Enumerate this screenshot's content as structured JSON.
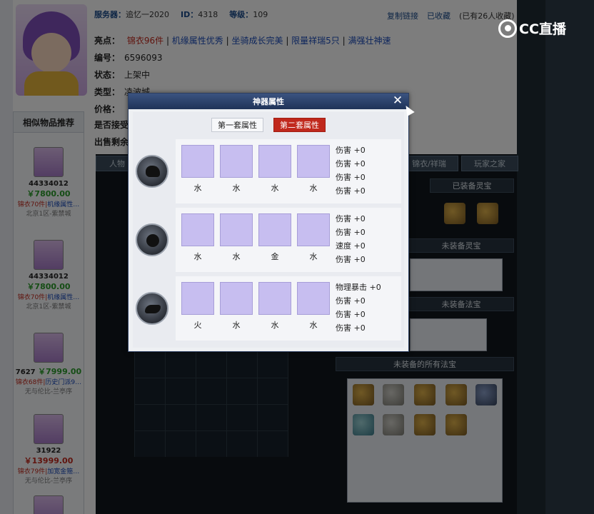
{
  "overlay": {
    "logo_text": "CC直播"
  },
  "page": {
    "server_label": "服务器：",
    "server_value": "追忆一2020",
    "id_label": "ID：",
    "id_value": "4318",
    "level_label": "等级：",
    "level_value": "109",
    "copy_link": "复制链接",
    "favorited": "已收藏",
    "fav_count": "(已有26人收藏)",
    "highlight_label": "亮点：",
    "highlight_items": [
      "锦衣96件",
      "机缘属性优秀",
      "坐骑成长完美",
      "限量祥瑞5只",
      "满强壮神速"
    ],
    "number_label": "编号：",
    "number_value": "6596093",
    "status_label": "状态：",
    "status_value": "上架中",
    "type_label": "类型：",
    "type_value": "凌波城",
    "price_label": "价格：",
    "accept_label": "是否接受",
    "remain_label": "出售剩余"
  },
  "sidebar": {
    "title": "相似物品推荐",
    "items": [
      {
        "id": "44334012",
        "price": "￥7800.00",
        "desc_red": "锦衣70件",
        "desc_blue": "机缘属性…",
        "server": "北京1区-紫禁城",
        "price_red": false
      },
      {
        "id": "44334012",
        "price": "￥7800.00",
        "desc_red": "锦衣70件",
        "desc_blue": "机缘属性…",
        "server": "北京1区-紫禁城",
        "price_red": false
      },
      {
        "id": "7627",
        "price": "￥7999.00",
        "desc_red": "锦衣68件",
        "desc_blue": "历史门派9…",
        "server": "无与伦比-兰亭序",
        "price_red": false
      },
      {
        "id": "31922",
        "price": "￥13999.00",
        "desc_red": "锦衣79件",
        "desc_blue": "加宽金箍…",
        "server": "无与伦比-兰亭序",
        "price_red": true
      }
    ]
  },
  "game": {
    "tab_left": "人物",
    "tab_mid": "锦衣/祥瑞",
    "tab_right": "玩家之家",
    "equipped_spirit": "已装备灵宝",
    "not_equipped_spirit": "未装备灵宝",
    "not_equipped_magic": "未装备法宝",
    "all_magic": "未装备的所有法宝"
  },
  "modal": {
    "title": "神器属性",
    "close": "✕",
    "tabs": [
      "第一套属性",
      "第二套属性"
    ],
    "active_tab": 1,
    "sets": [
      {
        "slots": [
          "水",
          "水",
          "水",
          "水"
        ],
        "stats": [
          "伤害 +0",
          "伤害 +0",
          "伤害 +0",
          "伤害 +0"
        ]
      },
      {
        "slots": [
          "水",
          "水",
          "金",
          "水"
        ],
        "stats": [
          "伤害 +0",
          "伤害 +0",
          "速度 +0",
          "伤害 +0"
        ]
      },
      {
        "slots": [
          "火",
          "水",
          "水",
          "水"
        ],
        "stats": [
          "物理暴击 +0",
          "伤害 +0",
          "伤害 +0",
          "伤害 +0"
        ]
      }
    ]
  }
}
